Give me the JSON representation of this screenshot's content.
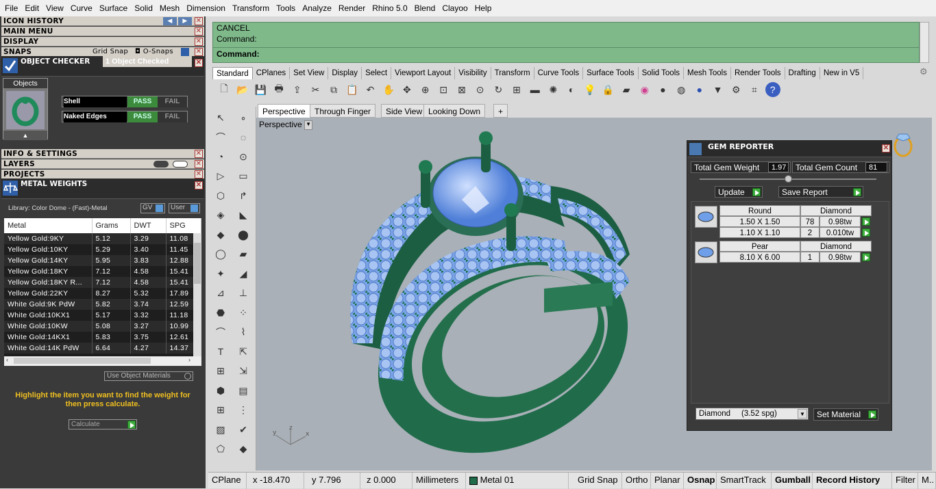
{
  "menu": [
    "File",
    "Edit",
    "View",
    "Curve",
    "Surface",
    "Solid",
    "Mesh",
    "Dimension",
    "Transform",
    "Tools",
    "Analyze",
    "Render",
    "Rhino 5.0",
    "Blend",
    "Clayoo",
    "Help"
  ],
  "left": {
    "icon_history": "ICON HISTORY",
    "main_menu": "MAIN MENU",
    "display": "DISPLAY",
    "snaps": "SNAPS",
    "grid_snap": "Grid Snap",
    "o_snaps": "O-Snaps",
    "object_checker": "OBJECT CHECKER",
    "objects_checked": "1  Object Checked",
    "objects_label": "Objects",
    "checks": [
      {
        "name": "Shell",
        "pass": "PASS",
        "fail": "FAIL"
      },
      {
        "name": "Naked Edges",
        "pass": "PASS",
        "fail": "FAIL"
      }
    ],
    "info_settings": "INFO & SETTINGS",
    "layers": "LAYERS",
    "projects": "PROJECTS",
    "metal_weights": "METAL WEIGHTS",
    "library": "Library: Color Dome - (Fast)-Metal",
    "gv": "GV",
    "user": "User",
    "columns": [
      "Metal",
      "Grams",
      "DWT",
      "SPG"
    ],
    "rows": [
      [
        "Yellow Gold:9KY",
        "5.12",
        "3.29",
        "11.08"
      ],
      [
        "Yellow Gold:10KY",
        "5.29",
        "3.40",
        "11.45"
      ],
      [
        "Yellow Gold:14KY",
        "5.95",
        "3.83",
        "12.88"
      ],
      [
        "Yellow Gold:18KY",
        "7.12",
        "4.58",
        "15.41"
      ],
      [
        "Yellow Gold:18KY R...",
        "7.12",
        "4.58",
        "15.41"
      ],
      [
        "Yellow Gold:22KY",
        "8.27",
        "5.32",
        "17.89"
      ],
      [
        "White Gold:9K PdW",
        "5.82",
        "3.74",
        "12.59"
      ],
      [
        "White Gold:10KX1",
        "5.17",
        "3.32",
        "11.18"
      ],
      [
        "White Gold:10KW",
        "5.08",
        "3.27",
        "10.99"
      ],
      [
        "White Gold:14KX1",
        "5.83",
        "3.75",
        "12.61"
      ],
      [
        "White Gold:14K PdW",
        "6.64",
        "4.27",
        "14.37"
      ]
    ],
    "use_object_materials": "Use Object Materials",
    "hint": "Highlight the item you want to find the weight for then press calculate.",
    "calculate": "Calculate"
  },
  "command": {
    "line1": "CANCEL",
    "line2": "Command:",
    "prompt": "Command:"
  },
  "tabs": [
    "Standard",
    "CPlanes",
    "Set View",
    "Display",
    "Select",
    "Viewport Layout",
    "Visibility",
    "Transform",
    "Curve Tools",
    "Surface Tools",
    "Solid Tools",
    "Mesh Tools",
    "Render Tools",
    "Drafting",
    "New in V5"
  ],
  "toolbar_icons": [
    "new-icon",
    "open-icon",
    "save-icon",
    "print-icon",
    "import-icon",
    "cut-icon",
    "copy-icon",
    "paste-icon",
    "undo-icon",
    "pan-icon",
    "rotate-view-icon",
    "zoom-icon",
    "zoom-window-icon",
    "zoom-extents-icon",
    "zoom-selected-icon",
    "rotate-icon",
    "four-views-icon",
    "car-icon",
    "sun-icon",
    "cplane-icon",
    "light-icon",
    "lock-icon",
    "layers-icon",
    "color-wheel-icon",
    "sphere-shaded-icon",
    "sphere-render-icon",
    "sphere-blue-icon",
    "lamp-icon",
    "gear-icon",
    "snap-icon",
    "help-icon"
  ],
  "viewport": {
    "tabs": [
      "Perspective",
      "Through Finger",
      "Side View",
      "Looking Down",
      "+"
    ],
    "label": "Perspective"
  },
  "gem": {
    "title": "GEM REPORTER",
    "total_weight_label": "Total Gem Weight",
    "total_weight": "1.97",
    "total_count_label": "Total Gem Count",
    "total_count": "81",
    "update": "Update",
    "save_report": "Save Report",
    "groups": [
      {
        "shape": "Round",
        "material": "Diamond",
        "rows": [
          [
            "1.50 X 1.50",
            "78",
            "0.98tw"
          ],
          [
            "1.10 X 1.10",
            "2",
            "0.010tw"
          ]
        ]
      },
      {
        "shape": "Pear",
        "material": "Diamond",
        "rows": [
          [
            "8.10 X 6.00",
            "1",
            "0.98tw"
          ]
        ]
      }
    ],
    "material_select": "Diamond     (3.52 spg)",
    "set_material": "Set Material"
  },
  "status": {
    "cplane": "CPlane",
    "x": "x -18.470",
    "y": "y 7.796",
    "z": "z 0.000",
    "units": "Millimeters",
    "layer": "Metal 01",
    "grid_snap": "Grid Snap",
    "ortho": "Ortho",
    "planar": "Planar",
    "osnap": "Osnap",
    "smarttrack": "SmartTrack",
    "gumball": "Gumball",
    "record_history": "Record History",
    "filter": "Filter",
    "more": "M.."
  },
  "colors": {
    "ring_green": "#1f6b4a",
    "gem_blue": "#6f9fe8",
    "command_green": "#7fb98a"
  }
}
